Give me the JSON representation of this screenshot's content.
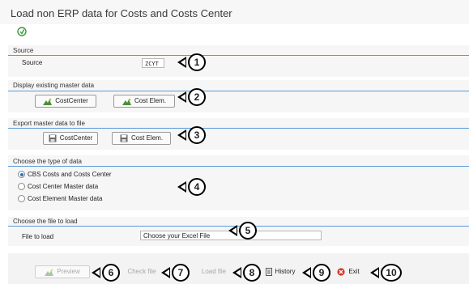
{
  "window": {
    "title": "Load non ERP data for Costs and Costs Center"
  },
  "source": {
    "section_title": "Source",
    "field_label": "Source",
    "field_value": "ZCYT"
  },
  "display": {
    "section_title": "Display existing master data",
    "costcenter": "CostCenter",
    "costelem": "Cost Elem."
  },
  "export": {
    "section_title": "Export master data to file",
    "costcenter": "CostCenter",
    "costelem": "Cost Elem."
  },
  "type": {
    "section_title": "Choose the type of data",
    "options": [
      "CBS Costs and Costs Center",
      "Cost Center Master data",
      "Cost Element Master data"
    ],
    "selected_index": 0
  },
  "file": {
    "section_title": "Choose the file to load",
    "field_label": "File to load",
    "field_value": "Choose your Excel File"
  },
  "toolbar": {
    "preview": "Preview",
    "check": "Check file",
    "load": "Load file",
    "history": "History",
    "exit": "Exit"
  },
  "callouts": [
    "1",
    "2",
    "3",
    "4",
    "5",
    "6",
    "7",
    "8",
    "9",
    "10"
  ]
}
